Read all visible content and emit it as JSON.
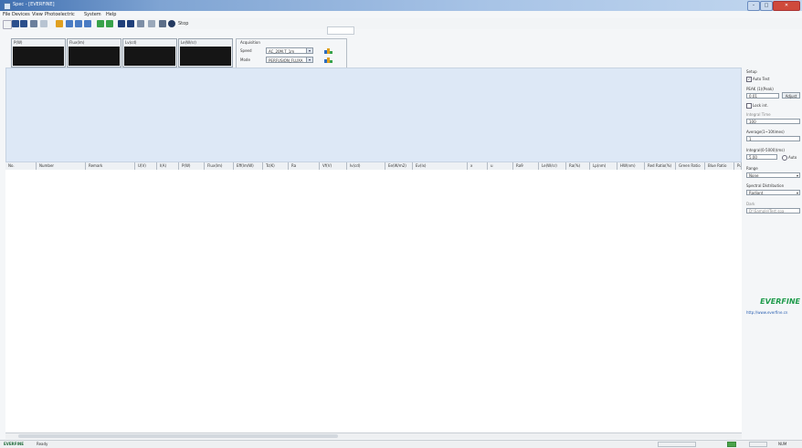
{
  "window": {
    "title": "Spec - [EVERFINE]"
  },
  "menu": [
    "File",
    "Devices",
    "View",
    "Photoelectric",
    "System",
    "Help"
  ],
  "toolbar": {
    "stop_label": "Stop"
  },
  "meters": [
    {
      "label": "P(W)",
      "unit": ""
    },
    {
      "label": "Flux(lm)",
      "unit": ""
    },
    {
      "label": "Lv(cd)",
      "unit": ""
    },
    {
      "label": "Le(W/sr)",
      "unit": ""
    }
  ],
  "acquisition": {
    "group_label": "Acquisition",
    "speed_label": "Speed",
    "speed_value": "AC_20M.T_1m",
    "mode_label": "Mode",
    "mode_value": "PERFUSION_FLUXA"
  },
  "table": {
    "columns": [
      "No.",
      "Number",
      "Remark",
      "U(V)",
      "I(A)",
      "P(W)",
      "Flux(lm)",
      "Eff(lm/W)",
      "Tc(K)",
      "Ra",
      "Vf(V)",
      "Iv(cd)",
      "Ee(W/m2)",
      "Ev(lx)",
      "x",
      "u",
      "Ra9",
      "Le(W/sr)",
      "Ra(%)",
      "Lp(nm)",
      "HW(nm)",
      "Red Ratio(%)",
      "Green Ratio",
      "Blue Ratio",
      "Pur"
    ]
  },
  "side": {
    "group_label": "Setup",
    "auto_label": "Auto Test",
    "peak_label": "PEAK (1)(Peak)",
    "peak_value": "0.01",
    "peak_btn": "Adjust",
    "lock_label": "Lock int.",
    "int_label": "Integral Time",
    "int_value": "100",
    "avg_label": "Average(1~10times)",
    "avg_value": "1",
    "ref_label": "Integral(0-5000)(ms)",
    "ref_value": "5.00",
    "ref_option": "Auto",
    "range_label": "Range",
    "range_value": "None",
    "mode_label": "Spectral Distribution",
    "mode_value": "Radiant",
    "extra_label": "Dark",
    "extra_value": "D:\\Sample\\Test.spa",
    "brand": "EVERFINE",
    "url": "http://www.everfine.cn"
  },
  "status": {
    "company": "EVERFINE",
    "ready": "Ready",
    "right_text": "NUM"
  },
  "colors": {
    "brand_green": "#1f9b4c",
    "graph_bg": "#dde8f6",
    "titlebar_blue": "#3f6fb0"
  }
}
